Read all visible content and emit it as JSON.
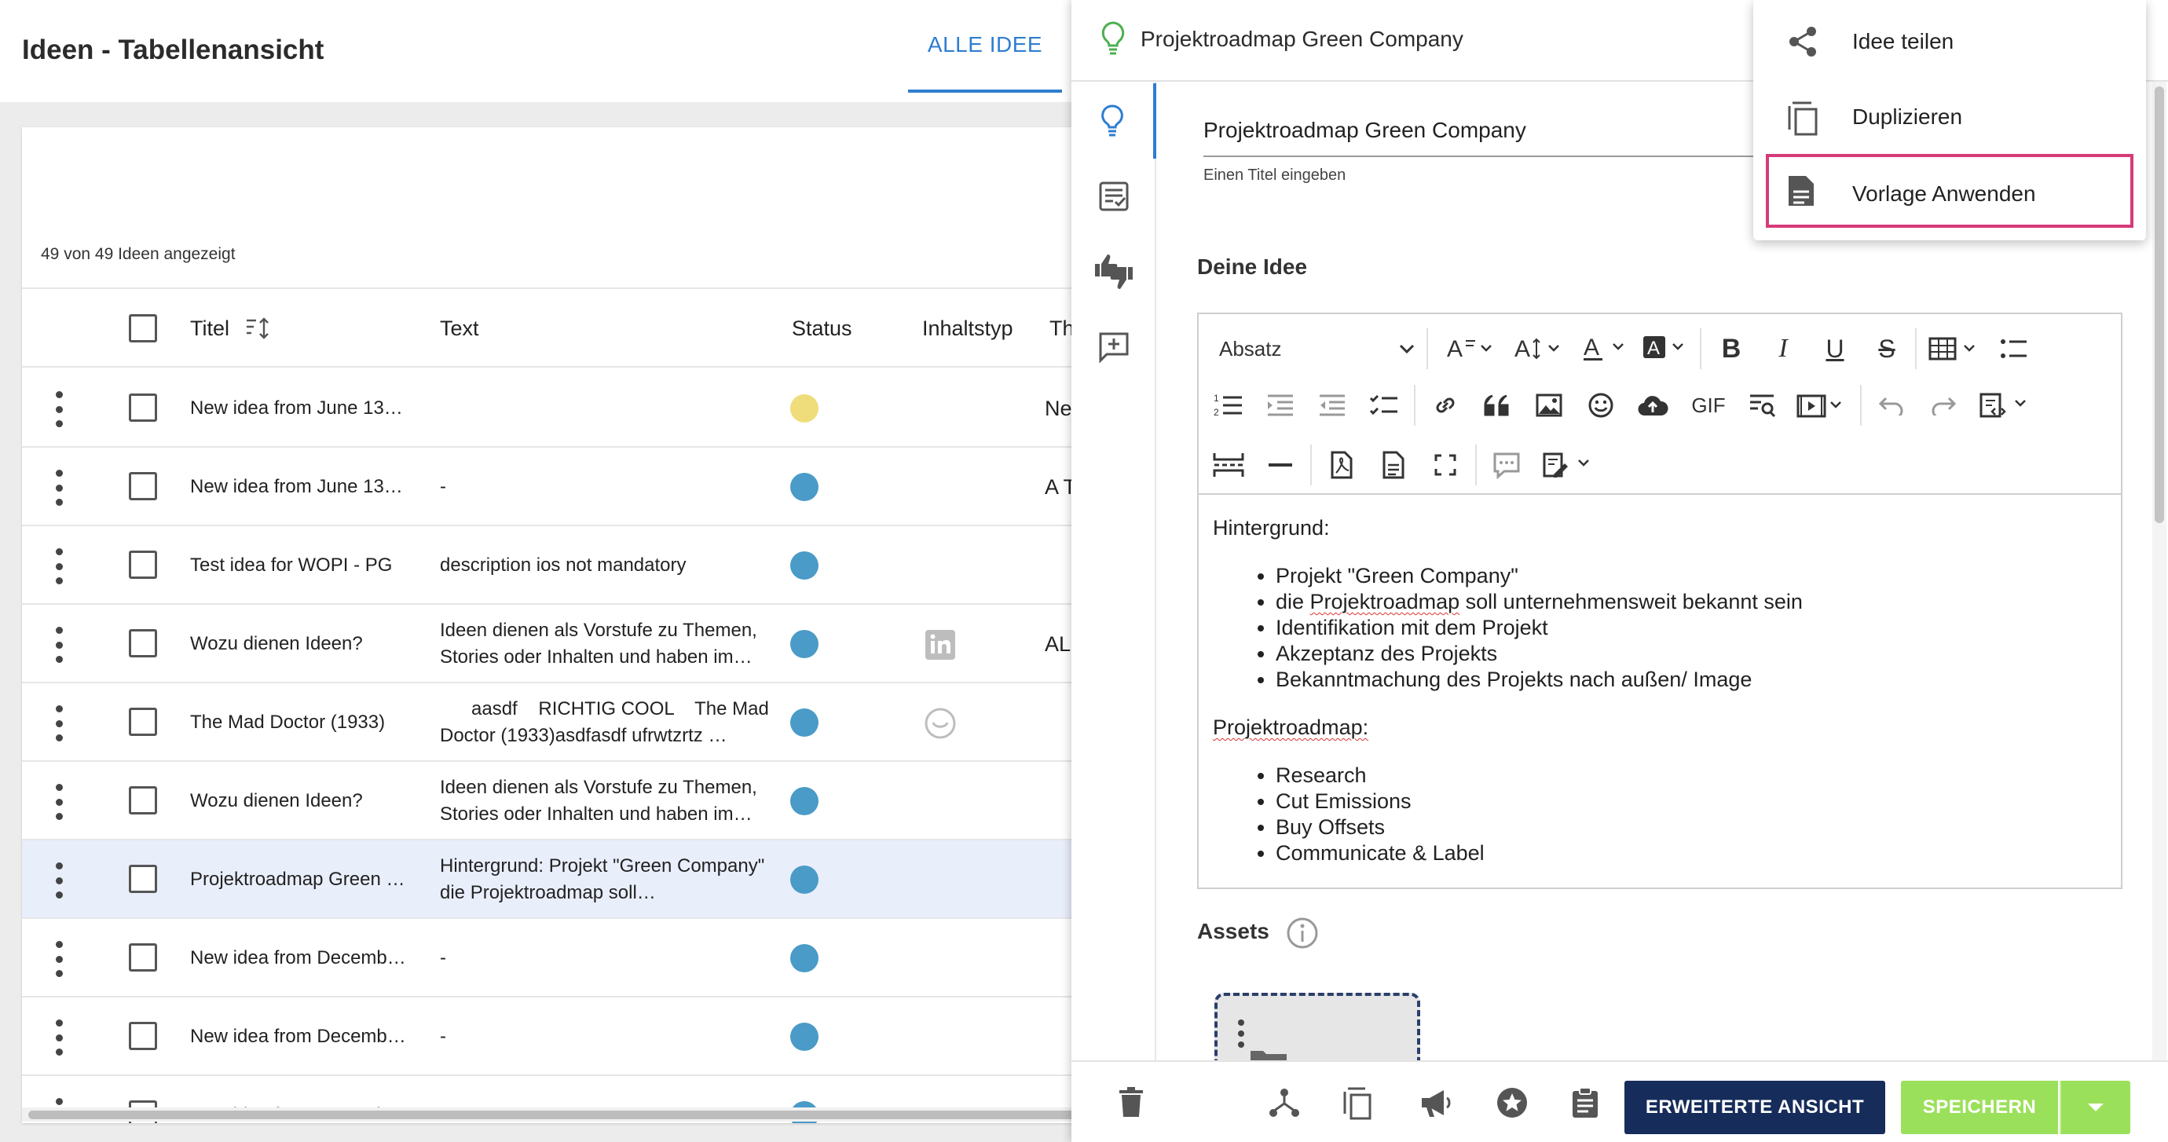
{
  "left": {
    "page_title": "Ideen - Tabellenansicht",
    "tab_label": "ALLE IDEE",
    "count_label": "49 von 49 Ideen angezeigt",
    "columns": [
      "Titel",
      "Text",
      "Status",
      "Inhaltstyp",
      "Th"
    ],
    "rows": [
      {
        "title": "New idea from June 13…",
        "text1": "",
        "text2": "",
        "status_color": "#eedd7a",
        "type_icon": "",
        "th": "Ne"
      },
      {
        "title": "New idea from June 13…",
        "text1": "-",
        "text2": "",
        "status_color": "#4a9bc7",
        "type_icon": "",
        "th": "A T"
      },
      {
        "title": "Test idea for WOPI - PG",
        "text1": "description ios not mandatory",
        "text2": "",
        "status_color": "#4a9bc7",
        "type_icon": "",
        "th": ""
      },
      {
        "title": "Wozu dienen Ideen?",
        "text1": "Ideen dienen als Vorstufe zu Themen,",
        "text2": "Stories oder Inhalten und haben im…",
        "status_color": "#4a9bc7",
        "type_icon": "linkedin-icon",
        "th": "AL"
      },
      {
        "title": "The Mad Doctor (1933)",
        "text1": "      aasdf    RICHTIG COOL    The Mad",
        "text2": "Doctor (1933)asdfasdf ufrwtzrtz  …",
        "status_color": "#4a9bc7",
        "type_icon": "smiley-icon",
        "th": ""
      },
      {
        "title": "Wozu dienen Ideen?",
        "text1": "Ideen dienen als Vorstufe zu Themen,",
        "text2": "Stories oder Inhalten und haben im…",
        "status_color": "#4a9bc7",
        "type_icon": "",
        "th": ""
      },
      {
        "title": "Projektroadmap Green …",
        "text1": "Hintergrund: Projekt \"Green Company\"",
        "text2": "die Projektroadmap soll…",
        "status_color": "#4a9bc7",
        "type_icon": "",
        "th": "",
        "selected": true
      },
      {
        "title": "New idea from Decemb…",
        "text1": "-",
        "text2": "",
        "status_color": "#4a9bc7",
        "type_icon": "",
        "th": ""
      },
      {
        "title": "New idea from Decemb…",
        "text1": "-",
        "text2": "",
        "status_color": "#4a9bc7",
        "type_icon": "",
        "th": ""
      },
      {
        "title": "New idea from Decemb…",
        "text1": "-",
        "text2": "",
        "status_color": "#4a9bc7",
        "type_icon": "",
        "th": ""
      }
    ]
  },
  "drawer": {
    "header_title": "Projektroadmap Green Company",
    "title_value": "Projektroadmap Green Company",
    "title_hint": "Einen Titel eingeben",
    "idea_heading": "Deine Idee",
    "paragraph_select": "Absatz",
    "toolbar_gif": "GIF",
    "content": {
      "bg_heading": "Hintergrund:",
      "bg_items": [
        "Projekt \"Green Company\"",
        "die Projektroadmap soll unternehmensweit bekannt sein",
        "Identifikation mit dem Projekt",
        "Akzeptanz des Projekts",
        "Bekanntmachung des Projekts nach außen/ Image"
      ],
      "roadmap_heading": "Projektroadmap:",
      "roadmap_items": [
        "Research",
        "Cut Emissions",
        "Buy Offsets",
        "Communicate & Label"
      ]
    },
    "assets_heading": "Assets",
    "footer": {
      "extended_view": "ERWEITERTE ANSICHT",
      "save": "SPEICHERN"
    }
  },
  "menu": {
    "items": [
      {
        "label": "Idee teilen",
        "icon": "share-icon"
      },
      {
        "label": "Duplizieren",
        "icon": "copy-icon"
      },
      {
        "label": "Vorlage Anwenden",
        "icon": "document-icon"
      }
    ]
  },
  "colors": {
    "accent_blue": "#2f7dd1",
    "navy_button": "#162c5a",
    "save_green": "#9be05a",
    "highlight_pink": "#d63a79",
    "bulb_green": "#4caf50"
  }
}
